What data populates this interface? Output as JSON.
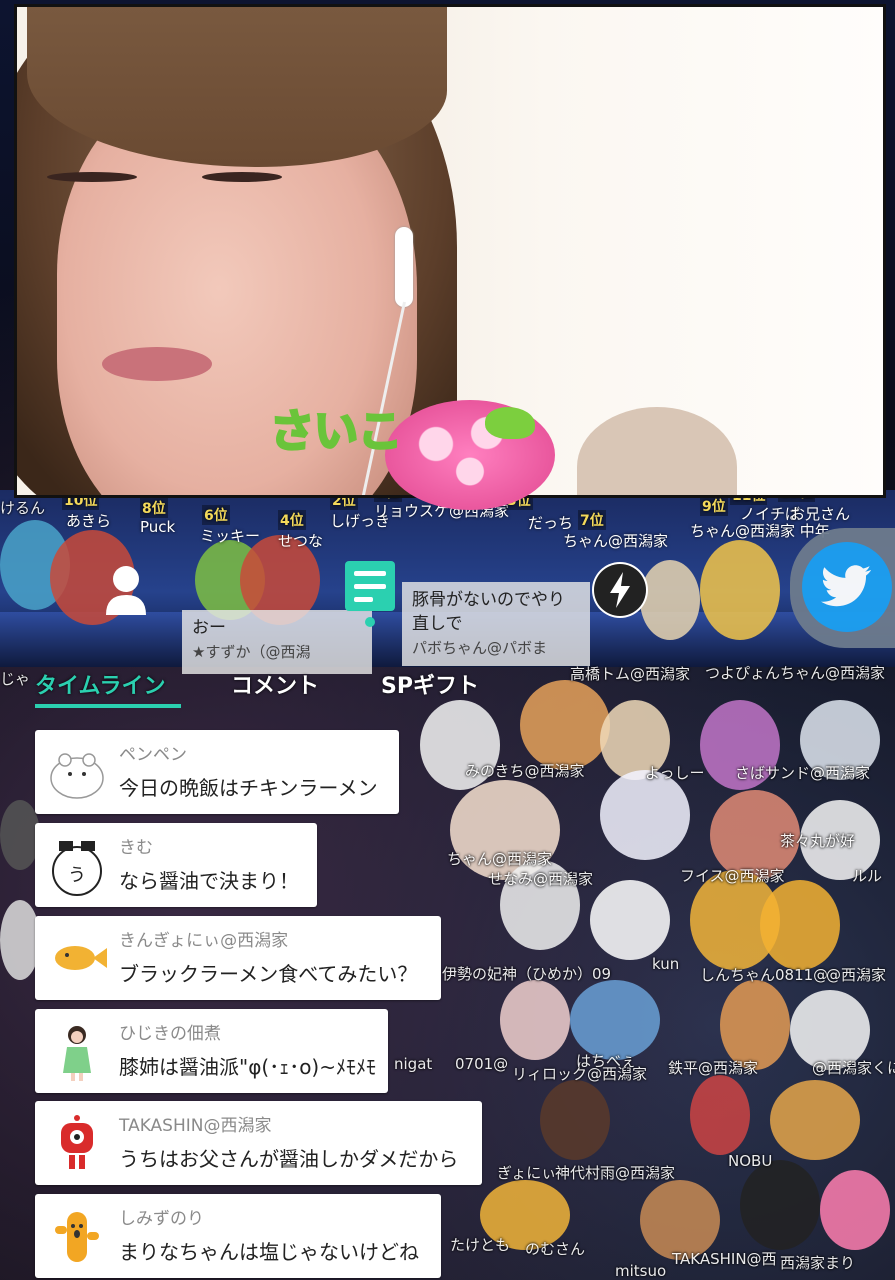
{
  "background": {
    "ranks": [
      {
        "rank": "10位",
        "name": "あきら"
      },
      {
        "rank": "8位",
        "name": "Puck"
      },
      {
        "rank": "6位",
        "name": "ミッキー"
      },
      {
        "rank": "4位",
        "name": "せつな"
      },
      {
        "rank": "2位",
        "name": "しげっき"
      },
      {
        "rank": "1位",
        "name": "リョウスケ@西潟家"
      },
      {
        "rank": "3位",
        "name": "だっち"
      },
      {
        "rank": "7位",
        "name": "ちゃん@西潟家"
      },
      {
        "rank": "9位",
        "name": "ちゃん@西潟家 中年"
      },
      {
        "rank": "11位",
        "name": "ノイチば"
      },
      {
        "rank": "13位",
        "name": "お兄さん"
      }
    ],
    "names": [
      "けるん",
      "じゃ",
      "高橋トム@西潟家",
      "つよぴょんちゃん@西潟家",
      "みのきち@西潟家",
      "よっしー",
      "さばサンド@西潟家",
      "せなみ@西潟家",
      "フイス@西潟家",
      "伊勢の妃神（ひめか）09",
      "しんちゃん0811@",
      "@西潟家",
      "kun",
      "nigat",
      "0701@",
      "リィロック@西潟家",
      "鉄平@西潟家",
      "@西潟家くに",
      "はちべぇ",
      "ぎょにぃ",
      "神代村雨@西潟家",
      "NOBU",
      "たけとも",
      "のむさん",
      "mitsuo",
      "TAKASHIN@西",
      "西潟家まり",
      "ちゃん@西潟家",
      "ルル",
      "茶々丸が好"
    ]
  },
  "stage_comments": [
    {
      "text": "おー",
      "user": "★すずか（@西潟"
    },
    {
      "text": "豚骨がないのでやり直しで",
      "user": "パボちゃん@パボま"
    }
  ],
  "gift_text": "さいこ",
  "tabs": {
    "timeline": "タイムライン",
    "comment": "コメント",
    "sp_gift": "SPギフト"
  },
  "colors": {
    "accent": "#2bd0b0",
    "twitter": "#1da1f2"
  },
  "timeline": [
    {
      "name": "ペンペン",
      "message": "今日の晩飯はチキンラーメン",
      "avatar": "polar-bear-avatar"
    },
    {
      "name": "きむ",
      "message": "なら醤油で決まり！",
      "avatar": "ramen-club-avatar"
    },
    {
      "name": "きんぎょにぃ@西潟家",
      "message": "ブラックラーメン食べてみたい？",
      "avatar": "goldfish-avatar"
    },
    {
      "name": "ひじきの佃煮",
      "message": "膝姉は醤油派\"φ(･ｪ･o)~ﾒﾓﾒﾓ",
      "avatar": "girl-avatar"
    },
    {
      "name": "TAKASHIN@西潟家",
      "message": "うちはお父さんが醤油しかダメだから",
      "avatar": "red-robot-avatar"
    },
    {
      "name": "しみずのり",
      "message": "まりなちゃんは塩じゃないけどね",
      "avatar": "cactus-avatar"
    }
  ]
}
